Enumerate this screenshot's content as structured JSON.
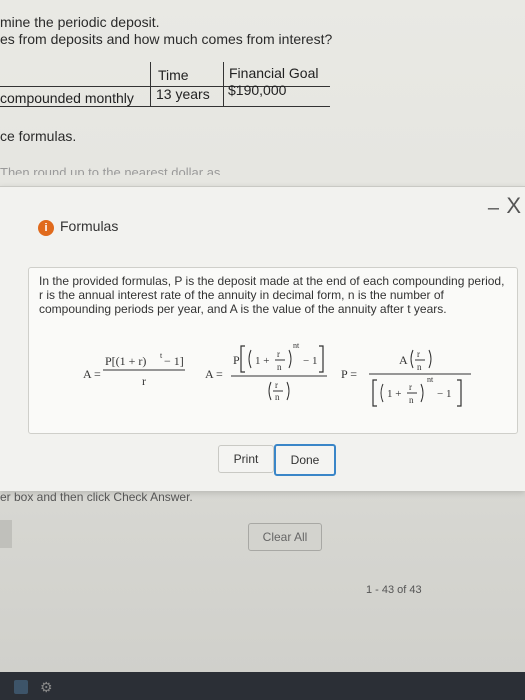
{
  "background": {
    "line1": "mine the periodic deposit.",
    "line2": "es from deposits and how much comes from interest?",
    "table": {
      "headers": [
        "Time",
        "Financial Goal"
      ],
      "row": [
        "compounded monthly",
        "13 years",
        "$190,000"
      ]
    },
    "line3": "ce formulas.",
    "faded": "Then round up to the nearest dollar as needed.)"
  },
  "dialog": {
    "minimize": "–",
    "close": "X",
    "info_icon": "i",
    "title": "Formulas",
    "description": "In the provided formulas, P is the deposit made at the end of each compounding period, r is the annual interest rate of the annuity in decimal form, n is the number of compounding periods per year, and A is the value of the annuity after t years.",
    "formula1": {
      "lhs": "A =",
      "numerator": "P[(1 + r)",
      "exp": "t",
      "tail": " − 1]",
      "denominator": "r"
    },
    "formula2": {
      "lhs": "A =",
      "P": "P",
      "one": "1 +",
      "r": "r",
      "n": "n",
      "exp": "nt",
      "minus": "− 1"
    },
    "formula3": {
      "lhs": "P =",
      "A": "A",
      "r": "r",
      "n": "n",
      "one": "1 +",
      "exp": "nt",
      "minus": "− 1"
    },
    "buttons": {
      "print": "Print",
      "done": "Done"
    }
  },
  "footer": {
    "hint": "er box and then click Check Answer.",
    "clear_all": "Clear All",
    "pager": "1 - 43 of 43"
  }
}
